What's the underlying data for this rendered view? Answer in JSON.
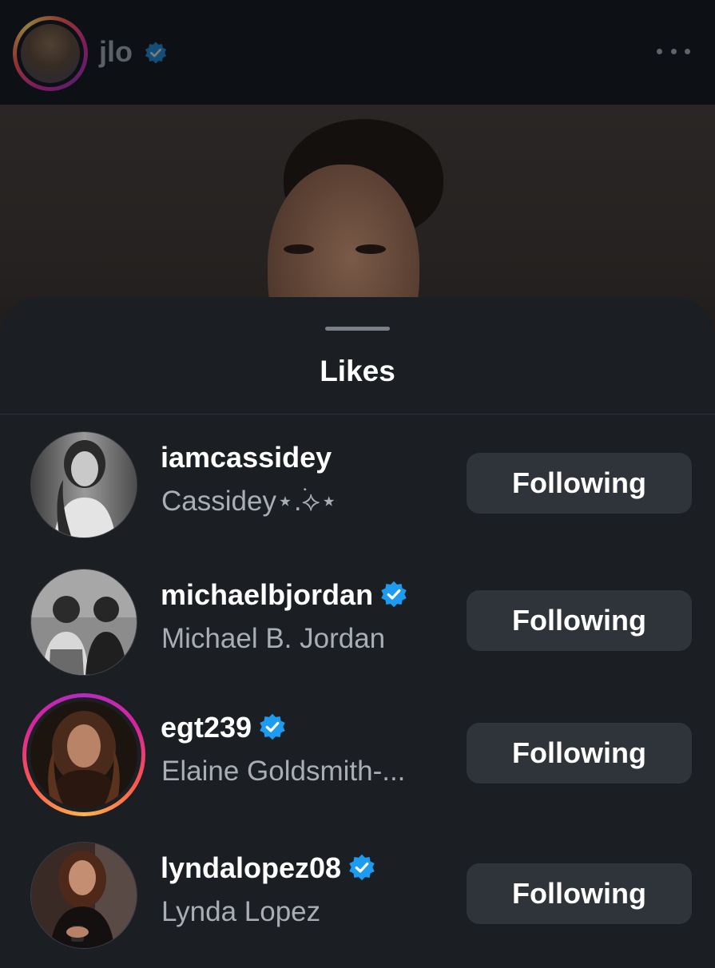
{
  "post": {
    "author_username": "jlo",
    "more_icon": "more-horizontal-icon"
  },
  "likes_sheet": {
    "title": "Likes",
    "users": [
      {
        "username": "iamcassidey",
        "full_name": "Cassidey⋆.࣪⟡⋆",
        "verified": false,
        "story_ring": false,
        "button_label": "Following"
      },
      {
        "username": "michaelbjordan",
        "full_name": "Michael B. Jordan",
        "verified": true,
        "story_ring": false,
        "button_label": "Following"
      },
      {
        "username": "egt239",
        "full_name": "Elaine Goldsmith-...",
        "verified": true,
        "story_ring": true,
        "button_label": "Following"
      },
      {
        "username": "lyndalopez08",
        "full_name": "Lynda Lopez",
        "verified": true,
        "story_ring": false,
        "button_label": "Following"
      }
    ]
  },
  "colors": {
    "verified_badge": "#1d9bf0",
    "sheet_background": "#1b1e23",
    "button_background": "#2f333a",
    "secondary_text": "#a9adb4"
  }
}
